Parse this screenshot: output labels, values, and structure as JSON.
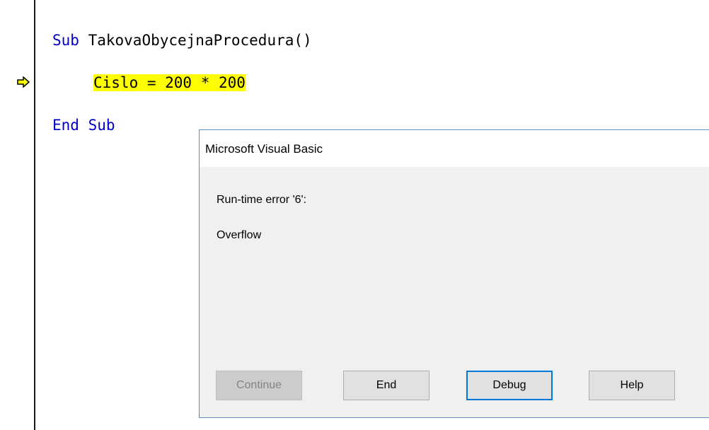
{
  "top_strip_text": "Sub TakovaObycejnaProcedura, ...",
  "code": {
    "line1": {
      "keyword": "Sub",
      "text": " TakovaObycejnaProcedura()"
    },
    "line2": {
      "text": "Cislo = 200 * 200",
      "highlighted": true,
      "highlight_color": "#ffff00"
    },
    "line3": {
      "text": "End Sub"
    },
    "execution_pointer_icon": "yellow-arrow-icon",
    "keyword_color": "#0000c8"
  },
  "dialog": {
    "title": "Microsoft Visual Basic",
    "message_line1": "Run-time error '6':",
    "message_line2": "Overflow",
    "buttons": {
      "continue": "Continue",
      "end": "End",
      "debug": "Debug",
      "help": "Help"
    },
    "accent_color": "#0078d7"
  }
}
